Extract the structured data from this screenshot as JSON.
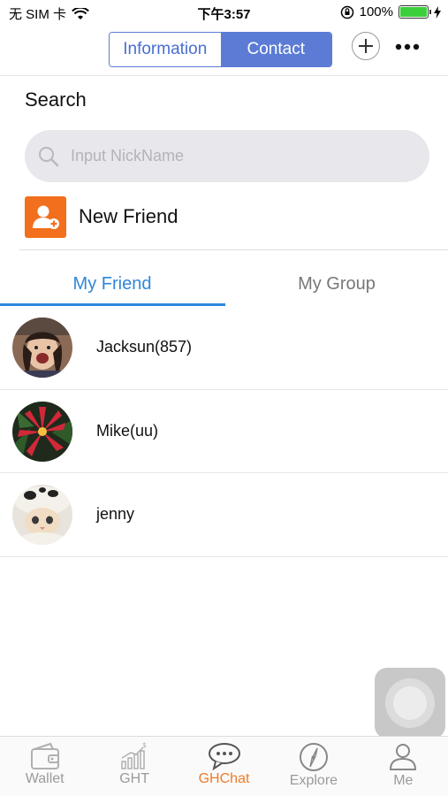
{
  "status_bar": {
    "carrier": "无 SIM 卡",
    "time": "下午3:57",
    "battery": "100%",
    "battery_level": 1.0
  },
  "nav": {
    "segments": [
      {
        "label": "Information",
        "selected": false
      },
      {
        "label": "Contact",
        "selected": true
      }
    ],
    "plus_icon": "plus-icon",
    "more_icon": "more-icon",
    "accent": "#5b7bd5"
  },
  "search": {
    "title": "Search",
    "placeholder": "Input NickName",
    "value": ""
  },
  "new_friend": {
    "label": "New Friend",
    "icon": "add-user-icon",
    "icon_color": "#f26f1d"
  },
  "tabs": [
    {
      "label": "My Friend",
      "active": true
    },
    {
      "label": "My Group",
      "active": false
    }
  ],
  "friends": [
    {
      "name": "Jacksun(857)",
      "avatar": "child-photo-avatar"
    },
    {
      "name": "Mike(uu)",
      "avatar": "red-flower-avatar"
    },
    {
      "name": "jenny",
      "avatar": "cat-photo-avatar"
    }
  ],
  "tabbar": [
    {
      "label": "Wallet",
      "icon": "wallet-icon",
      "active": false
    },
    {
      "label": "GHT",
      "icon": "chart-icon",
      "active": false
    },
    {
      "label": "GHChat",
      "icon": "chat-icon",
      "active": true
    },
    {
      "label": "Explore",
      "icon": "compass-icon",
      "active": false
    },
    {
      "label": "Me",
      "icon": "user-icon",
      "active": false
    }
  ],
  "colors": {
    "tab_active": "#2f86d9",
    "tabbar_active": "#f07a2a"
  }
}
